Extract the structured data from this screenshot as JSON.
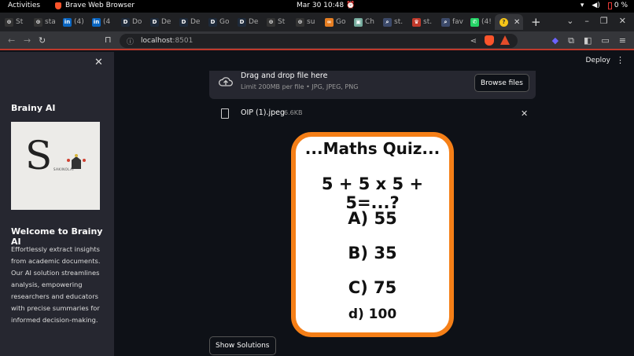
{
  "os": {
    "activities": "Activities",
    "app_name": "Brave Web Browser",
    "clock": "Mar 30  10:48",
    "battery": "0 %"
  },
  "tabs": [
    {
      "label": "St",
      "fav": "⊙",
      "color": "#333"
    },
    {
      "label": "sta",
      "fav": "⊙",
      "color": "#333"
    },
    {
      "label": "(4)",
      "fav": "in",
      "color": "#0a66c2"
    },
    {
      "label": "(4",
      "fav": "in",
      "color": "#0a66c2"
    },
    {
      "label": "Do",
      "fav": "D",
      "color": "#1e2a3a"
    },
    {
      "label": "De",
      "fav": "D",
      "color": "#1e2a3a"
    },
    {
      "label": "De",
      "fav": "D",
      "color": "#1e2a3a"
    },
    {
      "label": "Go",
      "fav": "D",
      "color": "#1e2a3a"
    },
    {
      "label": "De",
      "fav": "D",
      "color": "#1e2a3a"
    },
    {
      "label": "St",
      "fav": "⊙",
      "color": "#333"
    },
    {
      "label": "su",
      "fav": "⊙",
      "color": "#333"
    },
    {
      "label": "Go",
      "fav": "∞",
      "color": "#e67e22"
    },
    {
      "label": "Ch",
      "fav": "▣",
      "color": "#74aa9c"
    },
    {
      "label": "st.",
      "fav": "⌕",
      "color": "#3c4a6a"
    },
    {
      "label": "st.",
      "fav": "♛",
      "color": "#c0392b"
    },
    {
      "label": "fav",
      "fav": "⌕",
      "color": "#3c4a6a"
    },
    {
      "label": "(4!",
      "fav": "✆",
      "color": "#25d366"
    }
  ],
  "toolbar": {
    "url": "localhost",
    "port": ":8501"
  },
  "sidebar": {
    "brand": "Brainy AI",
    "logo_letter": "S",
    "logo_tag": "SAKINOLAI",
    "welcome": "Welcome to Brainy AI",
    "description": "Effortlessly extract insights from academic documents. Our AI solution streamlines analysis, empowering researchers and educators with precise summaries for informed decision-making."
  },
  "header": {
    "deploy": "Deploy"
  },
  "uploader": {
    "drag_text": "Drag and drop file here",
    "limit_text": "Limit 200MB per file • JPG, JPEG, PNG",
    "browse_label": "Browse files",
    "file_name": "OIP (1).jpeg",
    "file_size": "6.6KB"
  },
  "quiz_image": {
    "title": "...Maths Quiz...",
    "expression": "5 + 5 x 5 + 5=...?",
    "options": [
      "A) 55",
      "B) 35",
      "C) 75",
      "d) 100"
    ]
  },
  "actions": {
    "show_solutions": "Show Solutions"
  },
  "colors": {
    "accent": "#f57f17",
    "sidebar_bg": "#262730",
    "main_bg": "#0e1117"
  }
}
